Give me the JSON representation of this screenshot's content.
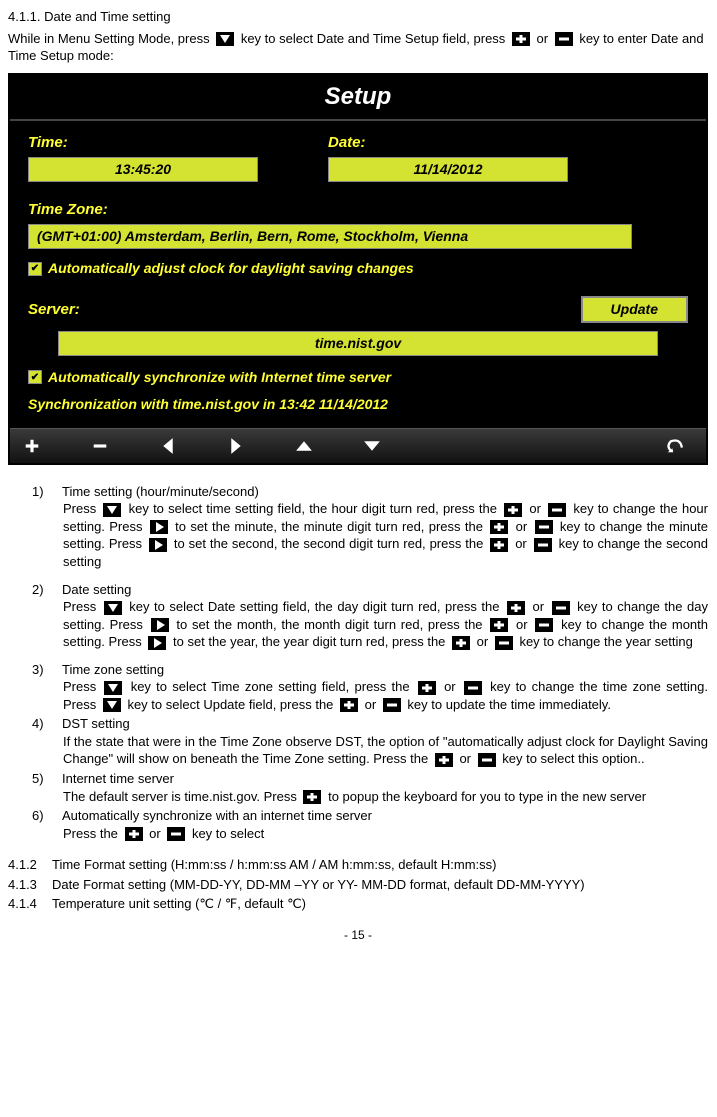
{
  "heading": "4.1.1. Date and Time setting",
  "intro_before": "While in Menu Setting Mode, press ",
  "intro_mid1": " key to select Date and Time Setup field, press ",
  "intro_or": " or ",
  "intro_after": " key to enter Date and Time Setup mode:",
  "setup": {
    "title": "Setup",
    "time_label": "Time:",
    "time_value": "13:45:20",
    "date_label": "Date:",
    "date_value": "11/14/2012",
    "tz_label": "Time Zone:",
    "tz_value": "(GMT+01:00) Amsterdam, Berlin, Bern, Rome, Stockholm, Vienna",
    "dst_text": "Automatically adjust clock for daylight saving changes",
    "server_label": "Server:",
    "update_btn": "Update",
    "server_value": "time.nist.gov",
    "autosync_text": "Automatically synchronize with Internet time server",
    "sync_status": "Synchronization with time.nist.gov in 13:42 11/14/2012"
  },
  "items": {
    "n1": "1)",
    "t1": "Time setting (hour/minute/second)",
    "p1a": "Press ",
    "p1b": " key to select time setting field, the hour digit turn red, press the ",
    "p1c": " or ",
    "p1d": " key to change the hour setting. Press ",
    "p1e": " to set the minute, the minute digit turn red, press the ",
    "p1f": " or ",
    "p1g": " key to change the minute setting. Press ",
    "p1h": " to set the second, the second digit turn red, press the ",
    "p1i": " or ",
    "p1j": " key to change the second setting",
    "n2": "2)",
    "t2": "Date setting",
    "p2a": "Press ",
    "p2b": " key to select Date setting field, the day digit turn red, press the ",
    "p2c": " or ",
    "p2d": " key to change the day setting. Press ",
    "p2e": " to set the month, the month digit turn red, press the ",
    "p2f": " or ",
    "p2g": " key to change the month setting. Press ",
    "p2h": " to set the year, the year digit turn red, press the ",
    "p2i": " or ",
    "p2j": " key to change the year setting",
    "n3": "3)",
    "t3": "Time zone setting",
    "p3a": "Press ",
    "p3b": " key to select Time zone setting field, press the ",
    "p3c": " or ",
    "p3d": " key to change the time zone setting. Press ",
    "p3e": " key to select Update field, press the ",
    "p3f": " or ",
    "p3g": " key to update the time immediately.",
    "n4": "4)",
    "t4": "DST setting",
    "p4a": "If the state that were in the Time Zone observe DST, the option of \"automatically adjust clock for Daylight Saving Change\" will show on beneath the Time Zone setting. Press the ",
    "p4b": " or ",
    "p4c": " key to select this option..",
    "n5": "5)",
    "t5": "Internet time server",
    "p5a": "The default server is time.nist.gov. Press ",
    "p5b": " to popup the keyboard for you to type in the new server",
    "n6": "6)",
    "t6": "Automatically synchronize with an internet time server",
    "p6a": "Press the ",
    "p6b": " or ",
    "p6c": " key to select"
  },
  "tail": {
    "n412": "4.1.2",
    "t412": "Time Format setting (H:mm:ss / h:mm:ss AM / AM h:mm:ss, default H:mm:ss)",
    "n413": "4.1.3",
    "t413": "Date Format setting (MM-DD-YY, DD-MM –YY or YY- MM-DD format, default DD-MM-YYYY)",
    "n414": "4.1.4",
    "t414": "Temperature unit setting (℃ / ℉, default ℃)"
  },
  "page_num": "- 15 -"
}
